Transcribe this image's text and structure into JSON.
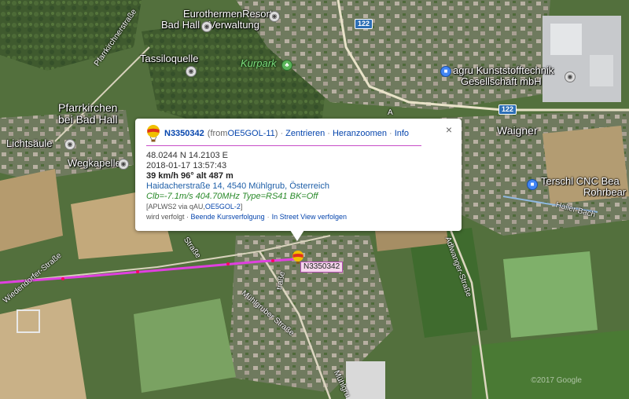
{
  "map": {
    "places": [
      {
        "id": "eurothermen",
        "text": "EurothermenResort"
      },
      {
        "id": "badhall-verw",
        "text": "Bad Hall - Verwaltung"
      },
      {
        "id": "tassiloquelle",
        "text": "Tassiloquelle"
      },
      {
        "id": "kurpark",
        "text": "Kurpark"
      },
      {
        "id": "pfarrkirchen1",
        "text": "Pfarrkirchen"
      },
      {
        "id": "pfarrkirchen2",
        "text": "bei Bad Hall"
      },
      {
        "id": "lichtsaeule",
        "text": "Lichtsäule"
      },
      {
        "id": "wegkapelle",
        "text": "Wegkapelle"
      },
      {
        "id": "agru1",
        "text": "agru Kunststofftechnik"
      },
      {
        "id": "agru2",
        "text": "Gesellschaft mbH"
      },
      {
        "id": "waigner",
        "text": "Waigner"
      },
      {
        "id": "terschl1",
        "text": "Terschl CNC Bea"
      },
      {
        "id": "terschl2",
        "text": "Rohrbear"
      }
    ],
    "streets": [
      {
        "id": "pfarrkirchnerstrasse",
        "text": "Pfarrkirchnerstraße"
      },
      {
        "id": "haller-bach",
        "text": "Haller Bach"
      },
      {
        "id": "adlwanger",
        "text": "Adlwanger-Straße"
      },
      {
        "id": "muehlgruber",
        "text": "Mühlgruber Straße"
      },
      {
        "id": "muehlgruber2",
        "text": "Mühlgru"
      },
      {
        "id": "wiedendorfer",
        "text": "Wiedendorfer-Straße"
      },
      {
        "id": "strasse-frag",
        "text": "Straße"
      },
      {
        "id": "a-frag",
        "text": "A"
      },
      {
        "id": "haidacher-frag",
        "text": "traße"
      }
    ],
    "road_shields": [
      "122",
      "122"
    ],
    "copyright": "©2017 Google",
    "colors": {
      "track": "#e040e0",
      "popup_rule": "#c84dc8",
      "marker_label_bg": "#f5d6ec"
    }
  },
  "popup": {
    "callsign": "N3350342",
    "from_prefix": "(from ",
    "from_station": "OE5GOL-11",
    "from_suffix": ")",
    "links": [
      "Zentrieren",
      "Heranzoomen",
      "Info"
    ],
    "close": "×",
    "coords": "48.0244 N 14.2103 E",
    "datetime": "2018-01-17 13:57:43",
    "speed": "39 km/h 96° alt 487 m",
    "address": "Haidacherstraße 14, 4540 Mühlgrub, Österreich",
    "comment": "Clb=-7.1m/s 404.70MHz Type=RS41 BK=Off",
    "path_prefix": "[APLWS2 via qAU,",
    "path_station": "OE5GOL-2",
    "path_suffix": "]",
    "tracked_prefix": "wird verfolgt · ",
    "tracked_links": [
      "Beende Kursverfolgung",
      "In Street View verfolgen"
    ]
  },
  "marker": {
    "label": "N3350342",
    "icon": "balloon-icon"
  }
}
